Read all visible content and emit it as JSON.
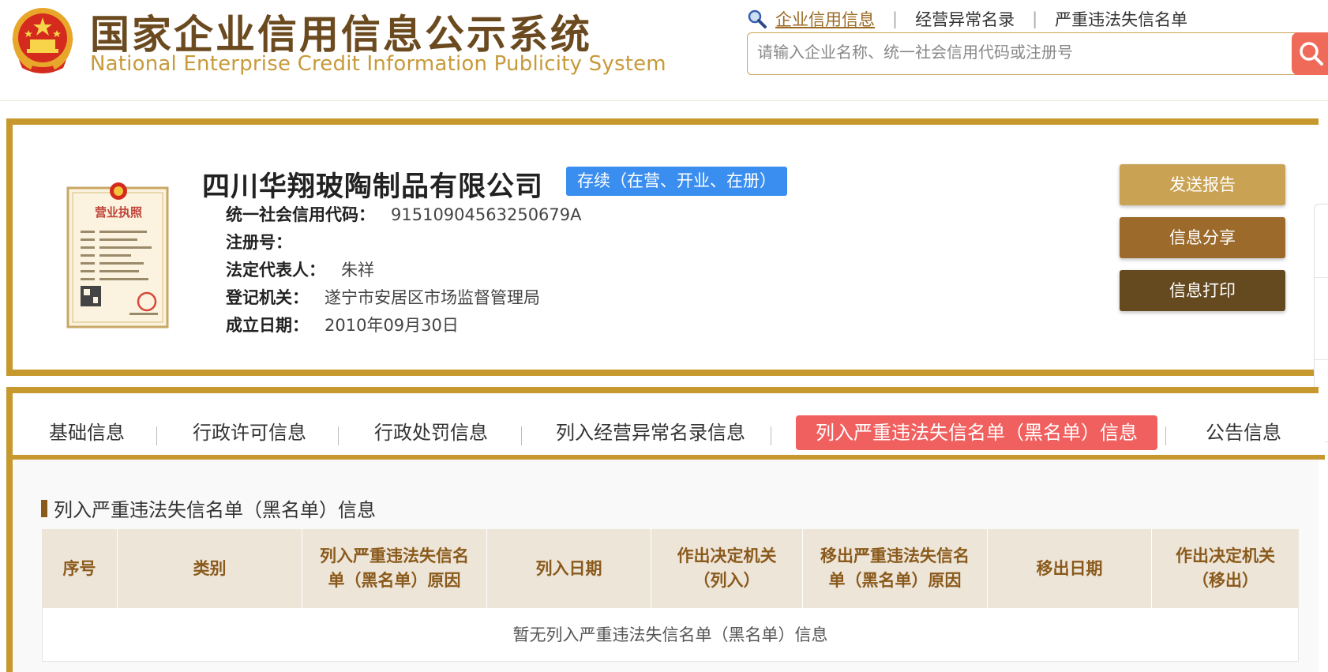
{
  "header": {
    "title_cn": "国家企业信用信息公示系统",
    "title_en": "National Enterprise Credit Information Publicity System",
    "links": [
      "企业信用信息",
      "经营异常名录",
      "严重违法失信名单"
    ],
    "search_placeholder": "请输入企业名称、统一社会信用代码或注册号"
  },
  "company": {
    "name": "四川华翔玻陶制品有限公司",
    "status": "存续（在营、开业、在册）",
    "fields": [
      {
        "label": "统一社会信用代码：",
        "value": "91510904563250679A"
      },
      {
        "label": "注册号：",
        "value": ""
      },
      {
        "label": "法定代表人：",
        "value": "朱祥"
      },
      {
        "label": "登记机关：",
        "value": "遂宁市安居区市场监督管理局"
      },
      {
        "label": "成立日期：",
        "value": "2010年09月30日"
      }
    ],
    "license_title": "营业执照"
  },
  "actions": [
    "发送报告",
    "信息分享",
    "信息打印"
  ],
  "tabs": [
    "基础信息",
    "行政许可信息",
    "行政处罚信息",
    "列入经营异常名录信息",
    "列入严重违法失信名单（黑名单）信息",
    "公告信息"
  ],
  "active_tab": 4,
  "section": {
    "title": "列入严重违法失信名单（黑名单）信息",
    "columns": [
      [
        "序号"
      ],
      [
        "类别"
      ],
      [
        "列入严重违法失信名",
        "单（黑名单）原因"
      ],
      [
        "列入日期"
      ],
      [
        "作出决定机关",
        "（列入）"
      ],
      [
        "移出严重违法失信名",
        "单（黑名单）原因"
      ],
      [
        "移出日期"
      ],
      [
        "作出决定机关",
        "（移出）"
      ]
    ],
    "empty_text": "暂无列入严重违法失信名单（黑名单）信息"
  },
  "colors": {
    "gold": "#c7982e",
    "brown": "#6b4a1f",
    "active_tab": "#f0605f",
    "status_badge": "#3a8ef0"
  }
}
